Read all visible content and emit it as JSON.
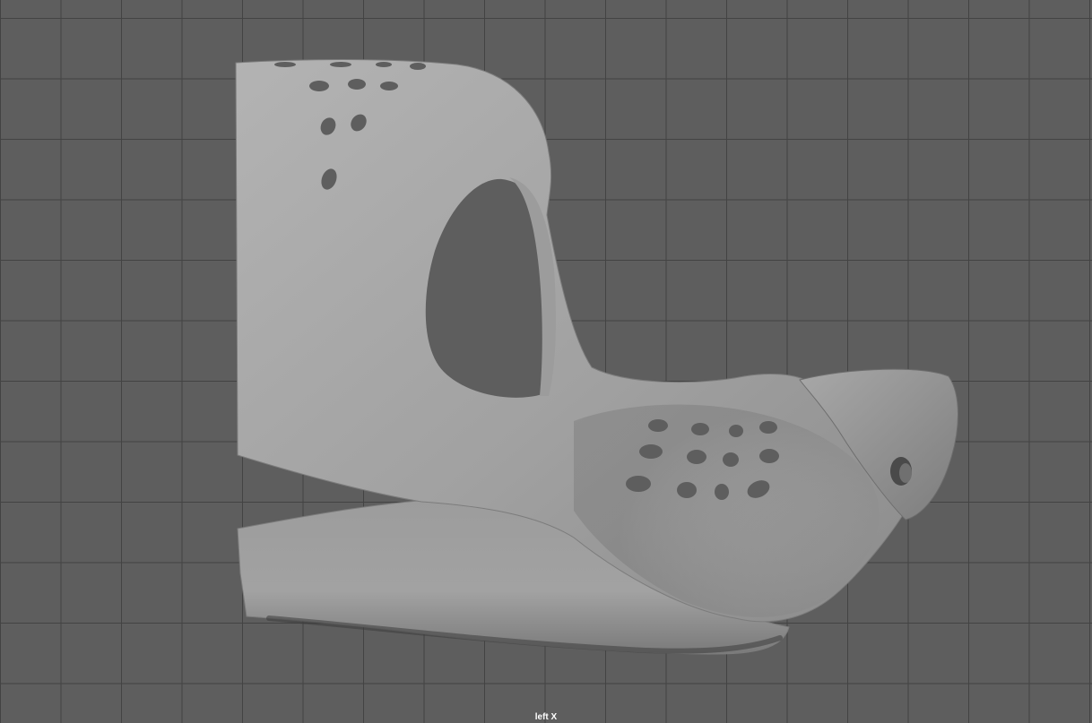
{
  "viewport": {
    "camera_label": "left X",
    "background_color": "#5e5e5e",
    "grid_color": "#434343",
    "model_color": "#a6a6a6"
  }
}
